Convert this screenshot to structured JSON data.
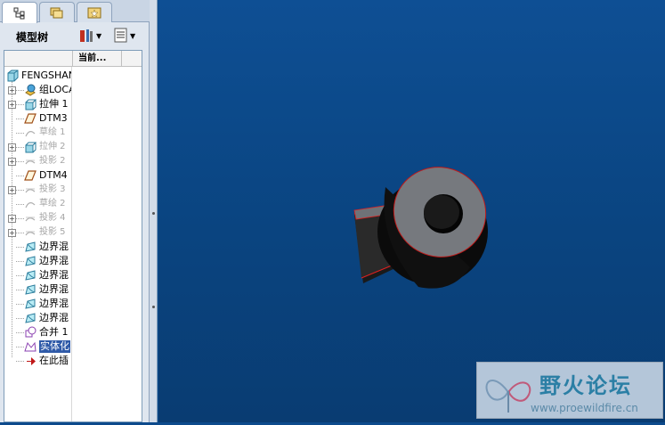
{
  "panel": {
    "title": "模型树",
    "column_current": "当前..."
  },
  "tree": {
    "root": "FENGSHAN",
    "items": [
      {
        "label": "组LOCAL",
        "icon": "group-icon",
        "expandable": true,
        "dim": false
      },
      {
        "label": "拉伸 1",
        "icon": "extrude-icon",
        "expandable": true,
        "dim": false
      },
      {
        "label": "DTM3",
        "icon": "datum-plane-icon",
        "expandable": false,
        "dim": false
      },
      {
        "label": "草绘 1",
        "icon": "sketch-icon",
        "expandable": false,
        "dim": true
      },
      {
        "label": "拉伸 2",
        "icon": "extrude-icon",
        "expandable": true,
        "dim": true
      },
      {
        "label": "投影 2",
        "icon": "projection-icon",
        "expandable": true,
        "dim": true
      },
      {
        "label": "DTM4",
        "icon": "datum-plane-icon",
        "expandable": false,
        "dim": false
      },
      {
        "label": "投影 3",
        "icon": "projection-icon",
        "expandable": true,
        "dim": true
      },
      {
        "label": "草绘 2",
        "icon": "sketch-icon",
        "expandable": false,
        "dim": true
      },
      {
        "label": "投影 4",
        "icon": "projection-icon",
        "expandable": true,
        "dim": true
      },
      {
        "label": "投影 5",
        "icon": "projection-icon",
        "expandable": true,
        "dim": true
      },
      {
        "label": "边界混",
        "icon": "boundary-blend-icon",
        "expandable": false,
        "dim": false
      },
      {
        "label": "边界混",
        "icon": "boundary-blend-icon",
        "expandable": false,
        "dim": false
      },
      {
        "label": "边界混",
        "icon": "boundary-blend-icon",
        "expandable": false,
        "dim": false
      },
      {
        "label": "边界混",
        "icon": "boundary-blend-icon",
        "expandable": false,
        "dim": false
      },
      {
        "label": "边界混",
        "icon": "boundary-blend-icon",
        "expandable": false,
        "dim": false
      },
      {
        "label": "边界混",
        "icon": "boundary-blend-icon",
        "expandable": false,
        "dim": false
      },
      {
        "label": "合并 1",
        "icon": "merge-icon",
        "expandable": false,
        "dim": false
      },
      {
        "label": "实体化",
        "icon": "solidify-icon",
        "expandable": false,
        "dim": false,
        "selected": true
      },
      {
        "label": "在此插",
        "icon": "insert-here-icon",
        "expandable": false,
        "dim": false
      }
    ]
  },
  "watermark": {
    "title": "野火论坛",
    "url": "www.proewildfire.cn"
  },
  "colors": {
    "viewport_bg": "#0d4a8c",
    "model_face": "#7a7d82",
    "model_dark": "#141414",
    "edge_highlight": "#e02020"
  }
}
